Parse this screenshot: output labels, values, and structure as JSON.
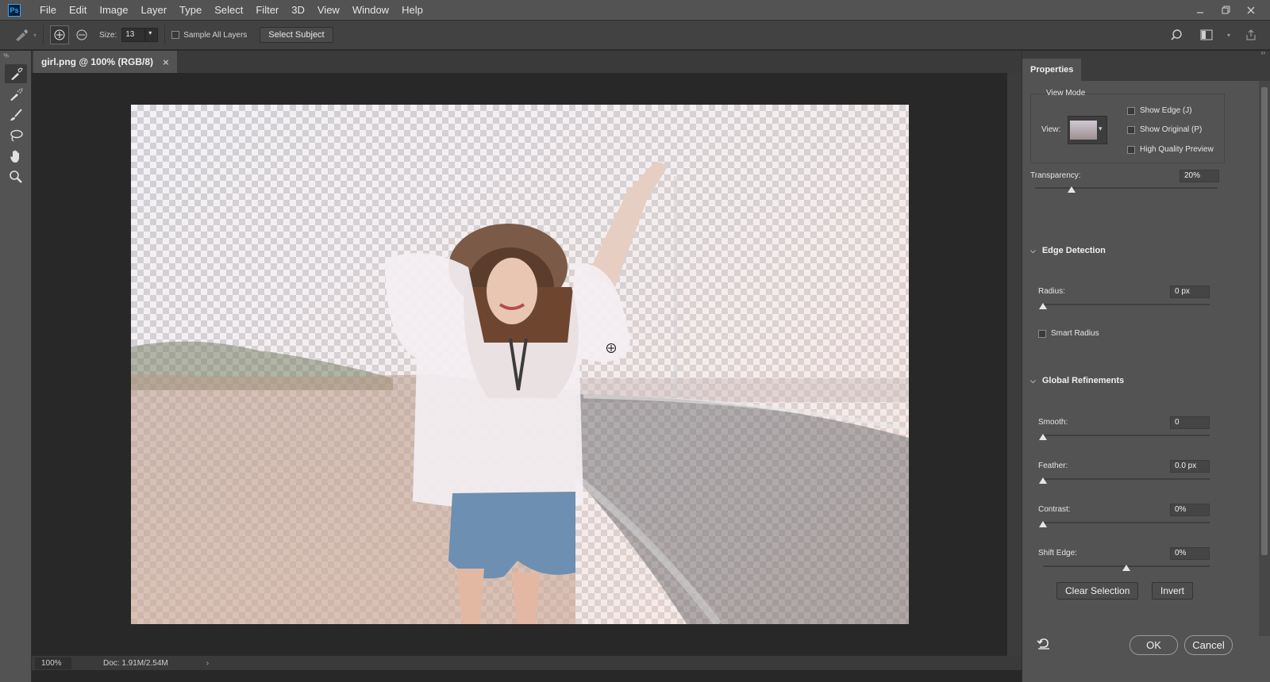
{
  "app": {
    "logo": "Ps"
  },
  "menu": [
    "File",
    "Edit",
    "Image",
    "Layer",
    "Type",
    "Select",
    "Filter",
    "3D",
    "View",
    "Window",
    "Help"
  ],
  "options": {
    "size_label": "Size:",
    "size_value": "13",
    "sample_all_layers": "Sample All Layers",
    "select_subject": "Select Subject"
  },
  "document": {
    "tab_title": "girl.png @ 100% (RGB/8)",
    "close": "×"
  },
  "status": {
    "zoom": "100%",
    "doc": "Doc: 1.91M/2.54M",
    "arrow": "›"
  },
  "panel": {
    "tab": "Properties",
    "view_mode": "View Mode",
    "view_label": "View:",
    "show_edge": "Show Edge (J)",
    "show_original": "Show Original (P)",
    "high_quality": "High Quality Preview",
    "transparency_label": "Transparency:",
    "transparency_value": "20%",
    "transparency_level": 0.2,
    "edge_detection": "Edge Detection",
    "radius_label": "Radius:",
    "radius_value": "0 px",
    "smart_radius": "Smart Radius",
    "global_refinements": "Global Refinements",
    "smooth_label": "Smooth:",
    "smooth_value": "0",
    "feather_label": "Feather:",
    "feather_value": "0.0 px",
    "contrast_label": "Contrast:",
    "contrast_value": "0%",
    "shift_label": "Shift Edge:",
    "shift_value": "0%",
    "clear_selection": "Clear Selection",
    "invert": "Invert",
    "ok": "OK",
    "cancel": "Cancel"
  },
  "colors": {
    "accent": "#31a8ff",
    "panel": "#535353",
    "canvas": "#282828"
  },
  "icons": [
    "quick-selection-icon",
    "refine-edge-brush-icon",
    "brush-icon",
    "lasso-icon",
    "hand-icon",
    "zoom-icon"
  ]
}
